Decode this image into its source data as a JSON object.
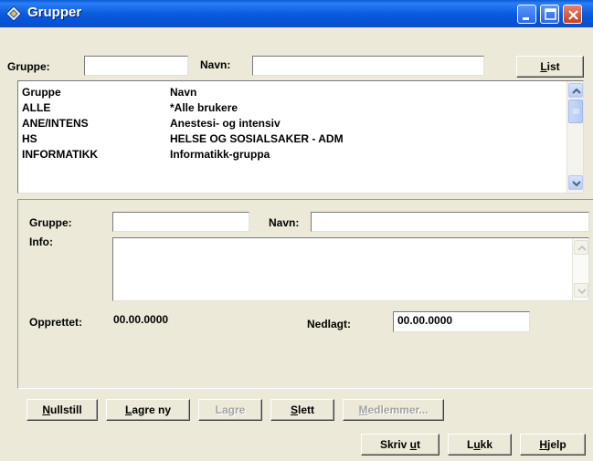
{
  "window": {
    "title": "Grupper",
    "icon": "diamond-app-icon"
  },
  "search": {
    "gruppe_label": "Gruppe:",
    "gruppe_value": "",
    "navn_label": "Navn:",
    "navn_value": "",
    "list_button": {
      "pre": "",
      "u": "L",
      "post": "ist"
    }
  },
  "list": {
    "headers": [
      "Gruppe",
      "Navn"
    ],
    "rows": [
      {
        "gruppe": "ALLE",
        "navn": "*Alle brukere"
      },
      {
        "gruppe": "ANE/INTENS",
        "navn": "Anestesi- og intensiv"
      },
      {
        "gruppe": "HS",
        "navn": "HELSE OG SOSIALSAKER - ADM"
      },
      {
        "gruppe": "INFORMATIKK",
        "navn": "Informatikk-gruppa"
      }
    ]
  },
  "detail": {
    "gruppe_label": "Gruppe:",
    "gruppe_value": "",
    "navn_label": "Navn:",
    "navn_value": "",
    "info_label": "Info:",
    "info_value": "",
    "opprettet_label": "Opprettet:",
    "opprettet_value": "00.00.0000",
    "nedlagt_label": "Nedlagt:",
    "nedlagt_value": "00.00.0000"
  },
  "buttons": {
    "nullstill": {
      "pre": "",
      "u": "N",
      "post": "ullstill"
    },
    "lagre_ny": {
      "pre": "",
      "u": "L",
      "post": "agre ny"
    },
    "lagre": {
      "pre": "Lagre",
      "u": "",
      "post": ""
    },
    "slett": {
      "pre": "",
      "u": "S",
      "post": "lett"
    },
    "medlemmer": {
      "pre": "",
      "u": "M",
      "post": "edlemmer..."
    },
    "skriv_ut": {
      "pre": "Skriv ",
      "u": "u",
      "post": "t"
    },
    "lukk": {
      "pre": "L",
      "u": "u",
      "post": "kk"
    },
    "hjelp": {
      "pre": "",
      "u": "H",
      "post": "jelp"
    }
  },
  "colors": {
    "titlebar": "#0b5ce0",
    "dialog_bg": "#ece9d8",
    "close_button": "#c9421e"
  }
}
